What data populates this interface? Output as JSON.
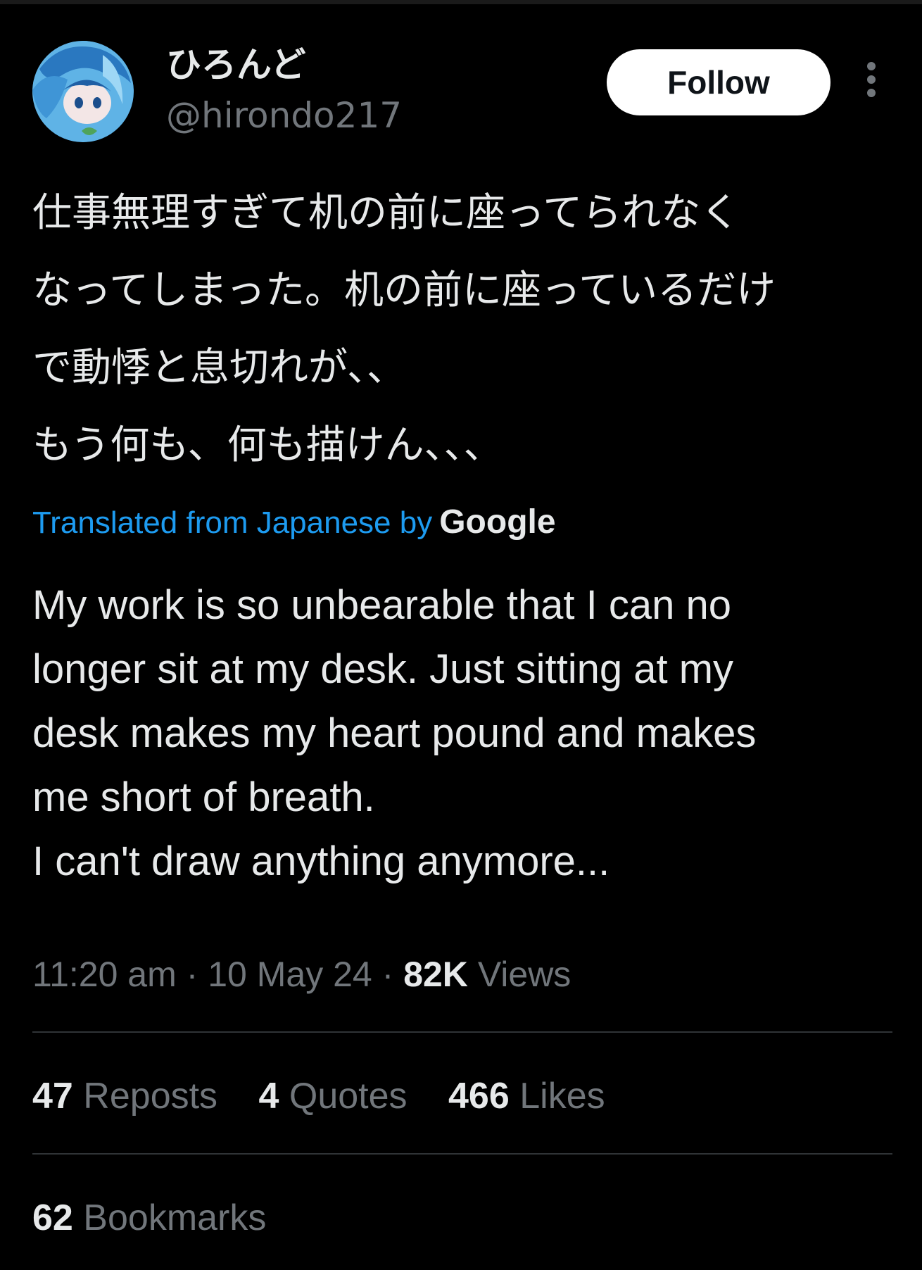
{
  "author": {
    "display_name": "ひろんど",
    "handle": "@hirondo217",
    "avatar_icon": "avatar-illustration-icon"
  },
  "follow_button": {
    "label": "Follow"
  },
  "more_icon": "more-vertical-icon",
  "tweet": {
    "original_text": "仕事無理すぎて机の前に座ってられなく\nなってしまった。机の前に座っているだけ\nで動悸と息切れが、、\nもう何も、何も描けん、、、",
    "translation_label": "Translated from Japanese by",
    "translation_provider": "Google",
    "translated_text": "My work is so unbearable that I can no\nlonger sit at my desk. Just sitting at my\ndesk makes my heart pound and makes\nme short of breath.\nI can't draw anything anymore..."
  },
  "meta": {
    "time": "11:20 am",
    "date": "10 May 24",
    "views_count": "82K",
    "views_label": "Views"
  },
  "stats": {
    "reposts_count": "47",
    "reposts_label": "Reposts",
    "quotes_count": "4",
    "quotes_label": "Quotes",
    "likes_count": "466",
    "likes_label": "Likes",
    "bookmarks_count": "62",
    "bookmarks_label": "Bookmarks"
  },
  "colors": {
    "background": "#000000",
    "text_primary": "#e7e9ea",
    "text_secondary": "#71767b",
    "link_blue": "#1d9bf0",
    "divider": "#2f3336"
  }
}
